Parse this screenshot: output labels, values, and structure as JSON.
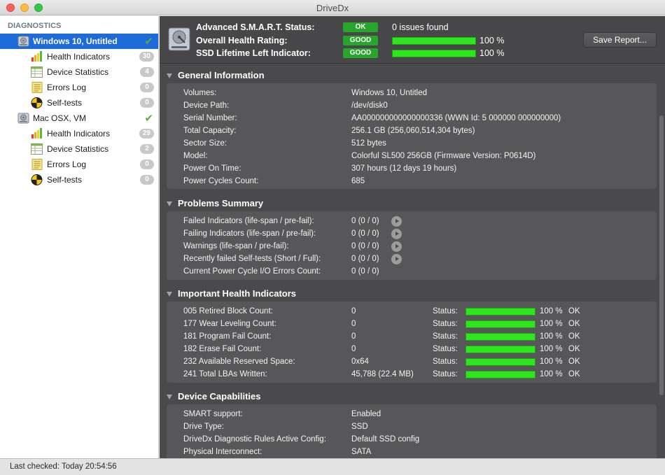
{
  "window": {
    "title": "DriveDx"
  },
  "sidebar": {
    "header": "DIAGNOSTICS",
    "drives": [
      {
        "name": "Windows 10, Untitled",
        "items": [
          {
            "label": "Health Indicators",
            "count": "30"
          },
          {
            "label": "Device Statistics",
            "count": "4"
          },
          {
            "label": "Errors Log",
            "count": "0"
          },
          {
            "label": "Self-tests",
            "count": "0"
          }
        ]
      },
      {
        "name": "Mac OSX, VM",
        "items": [
          {
            "label": "Health Indicators",
            "count": "29"
          },
          {
            "label": "Device Statistics",
            "count": "2"
          },
          {
            "label": "Errors Log",
            "count": "0"
          },
          {
            "label": "Self-tests",
            "count": "0"
          }
        ]
      }
    ]
  },
  "status": {
    "smart_label": "Advanced S.M.A.R.T. Status:",
    "smart_pill": "OK",
    "smart_text": "0 issues found",
    "health_label": "Overall Health Rating:",
    "health_pill": "GOOD",
    "health_value": "100 %",
    "health_fraction": 1.0,
    "ssd_label": "SSD Lifetime Left Indicator:",
    "ssd_pill": "GOOD",
    "ssd_value": "100 %",
    "ssd_fraction": 1.0,
    "save_button": "Save Report..."
  },
  "general": {
    "title": "General Information",
    "rows": [
      {
        "k": "Volumes:",
        "v": "Windows 10, Untitled"
      },
      {
        "k": "Device Path:",
        "v": "/dev/disk0"
      },
      {
        "k": "Serial Number:",
        "v": "AA000000000000000336 (WWN Id: 5 000000 000000000)"
      },
      {
        "k": "Total Capacity:",
        "v": "256.1 GB (256,060,514,304 bytes)"
      },
      {
        "k": "Sector Size:",
        "v": "512 bytes"
      },
      {
        "k": "Model:",
        "v": "Colorful SL500 256GB  (Firmware Version: P0614D)"
      },
      {
        "k": "Power On Time:",
        "v": "307 hours (12 days 19 hours)"
      },
      {
        "k": "Power Cycles Count:",
        "v": "685"
      }
    ]
  },
  "problems": {
    "title": "Problems Summary",
    "rows": [
      {
        "k": "Failed Indicators (life-span / pre-fail):",
        "v": "0 (0 / 0)"
      },
      {
        "k": "Failing Indicators (life-span / pre-fail):",
        "v": "0 (0 / 0)"
      },
      {
        "k": "Warnings (life-span / pre-fail):",
        "v": "0 (0 / 0)"
      },
      {
        "k": "Recently failed Self-tests (Short / Full):",
        "v": "0 (0 / 0)"
      },
      {
        "k": "Current Power Cycle I/O Errors Count:",
        "v": "0 (0 / 0)"
      }
    ]
  },
  "health": {
    "title": "Important Health Indicators",
    "status_label": "Status:",
    "rows": [
      {
        "k": "005  Retired Block Count:",
        "v": "0",
        "pct": "100 %",
        "state": "OK"
      },
      {
        "k": "177  Wear Leveling Count:",
        "v": "0",
        "pct": "100 %",
        "state": "OK"
      },
      {
        "k": "181  Program Fail Count:",
        "v": "0",
        "pct": "100 %",
        "state": "OK"
      },
      {
        "k": "182  Erase Fail Count:",
        "v": "0",
        "pct": "100 %",
        "state": "OK"
      },
      {
        "k": "232  Available Reserved Space:",
        "v": "0x64",
        "pct": "100 %",
        "state": "OK"
      },
      {
        "k": "241  Total LBAs Written:",
        "v": "45,788 (22.4 MB)",
        "pct": "100 %",
        "state": "OK"
      }
    ]
  },
  "capabilities": {
    "title": "Device Capabilities",
    "rows": [
      {
        "k": "SMART support:",
        "v": "Enabled"
      },
      {
        "k": "Drive Type:",
        "v": "SSD"
      },
      {
        "k": "DriveDx Diagnostic Rules Active Config:",
        "v": "Default SSD config"
      },
      {
        "k": "Physical Interconnect:",
        "v": "SATA"
      }
    ]
  },
  "footer": {
    "text": "Last checked: Today 20:54:56"
  },
  "colors": {
    "accent": "#1d6ad9",
    "good": "#28a62c",
    "bar": "#2ee61e",
    "panel": "#575759"
  }
}
